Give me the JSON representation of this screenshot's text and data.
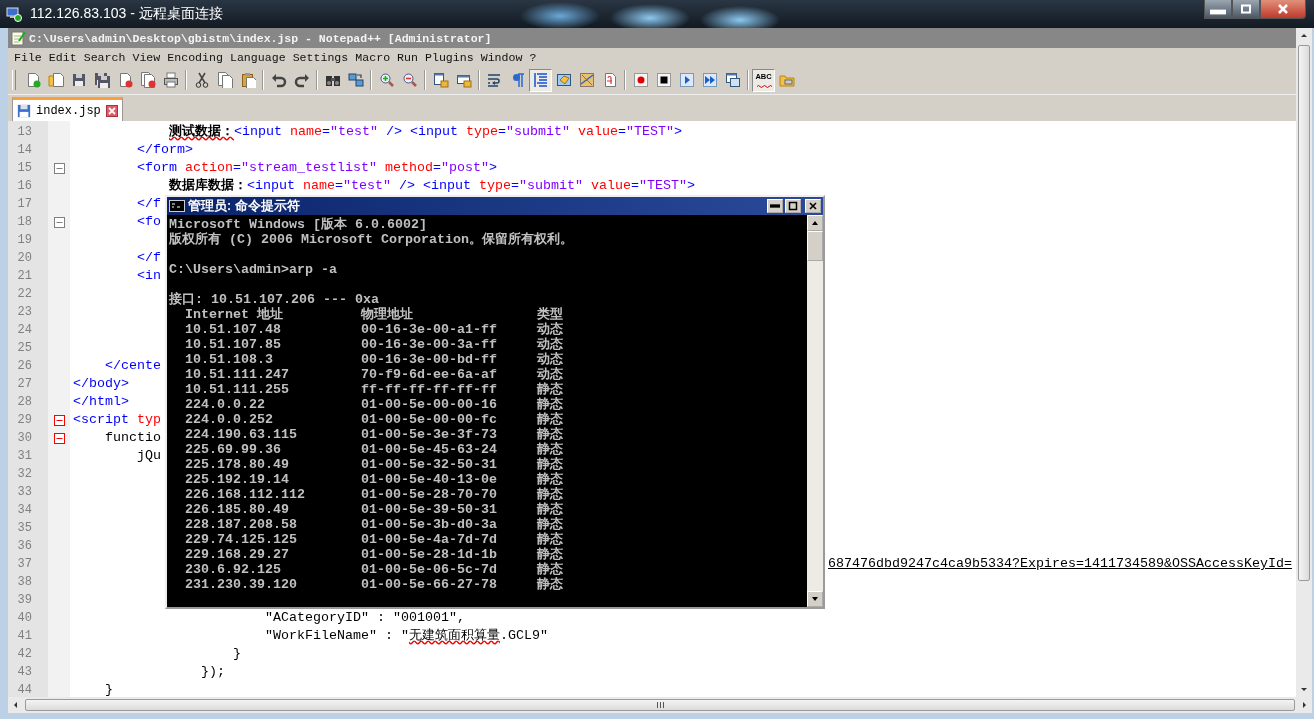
{
  "remote_window": {
    "title": "112.126.83.103 - 远程桌面连接"
  },
  "editor_window": {
    "title": "C:\\Users\\admin\\Desktop\\gbistm\\index.jsp - Notepad++ [Administrator]"
  },
  "menu": [
    "File",
    "Edit",
    "Search",
    "View",
    "Encoding",
    "Language",
    "Settings",
    "Macro",
    "Run",
    "Plugins",
    "Window",
    "?"
  ],
  "toolbar": [
    {
      "kind": "new",
      "pressed": false
    },
    {
      "kind": "open",
      "pressed": false
    },
    {
      "kind": "save",
      "pressed": false
    },
    {
      "kind": "save-all",
      "pressed": false
    },
    {
      "kind": "close",
      "pressed": false
    },
    {
      "kind": "close-all",
      "pressed": false
    },
    {
      "kind": "print",
      "pressed": false
    },
    {
      "kind": "separator"
    },
    {
      "kind": "cut",
      "pressed": false
    },
    {
      "kind": "copy",
      "pressed": false
    },
    {
      "kind": "paste",
      "pressed": false
    },
    {
      "kind": "separator"
    },
    {
      "kind": "undo",
      "pressed": false
    },
    {
      "kind": "redo",
      "pressed": false
    },
    {
      "kind": "separator"
    },
    {
      "kind": "find",
      "pressed": false
    },
    {
      "kind": "replace",
      "pressed": false
    },
    {
      "kind": "separator"
    },
    {
      "kind": "zoom-in",
      "pressed": false
    },
    {
      "kind": "zoom-out",
      "pressed": false
    },
    {
      "kind": "separator"
    },
    {
      "kind": "sync-v",
      "pressed": false
    },
    {
      "kind": "sync-h",
      "pressed": false
    },
    {
      "kind": "separator"
    },
    {
      "kind": "wrap",
      "pressed": false
    },
    {
      "kind": "all-chars",
      "pressed": false
    },
    {
      "kind": "indent-guide",
      "pressed": true
    },
    {
      "kind": "udl",
      "pressed": false
    },
    {
      "kind": "doc-map",
      "pressed": false
    },
    {
      "kind": "func-list",
      "pressed": false
    },
    {
      "kind": "separator"
    },
    {
      "kind": "record",
      "pressed": false
    },
    {
      "kind": "stop",
      "pressed": false
    },
    {
      "kind": "play",
      "pressed": false
    },
    {
      "kind": "play-multi",
      "pressed": false
    },
    {
      "kind": "save-macro",
      "pressed": false
    },
    {
      "kind": "separator"
    },
    {
      "kind": "spell",
      "label": "ABC",
      "pressed": true
    },
    {
      "kind": "folder",
      "pressed": false
    }
  ],
  "tabs": [
    {
      "label": "index.jsp",
      "selected": true
    }
  ],
  "lines": [
    {
      "num": "13",
      "segs": [
        {
          "kind": "bold-flagged",
          "t": "            测试数据："
        },
        {
          "kind": "tag",
          "t": "<input "
        },
        {
          "kind": "attr",
          "t": "name"
        },
        {
          "kind": "tag",
          "t": "="
        },
        {
          "kind": "value",
          "t": "\"test\""
        },
        {
          "kind": "tag",
          "t": " /> <input "
        },
        {
          "kind": "attr",
          "t": "type"
        },
        {
          "kind": "tag",
          "t": "="
        },
        {
          "kind": "value",
          "t": "\"submit\""
        },
        {
          "kind": "attr",
          "t": " value"
        },
        {
          "kind": "tag",
          "t": "="
        },
        {
          "kind": "value",
          "t": "\"TEST\""
        },
        {
          "kind": "tag",
          "t": ">"
        }
      ]
    },
    {
      "num": "14",
      "segs": [
        {
          "kind": "tag",
          "t": "        </form>"
        }
      ]
    },
    {
      "num": "15",
      "fold": {
        "expanded": true,
        "active": false
      },
      "segs": [
        {
          "kind": "tag",
          "t": "        <form "
        },
        {
          "kind": "attr",
          "t": "action"
        },
        {
          "kind": "tag",
          "t": "="
        },
        {
          "kind": "value",
          "t": "\"stream_testlist\""
        },
        {
          "kind": "attr",
          "t": " method"
        },
        {
          "kind": "tag",
          "t": "="
        },
        {
          "kind": "value",
          "t": "\"post\""
        },
        {
          "kind": "tag",
          "t": ">"
        }
      ]
    },
    {
      "num": "16",
      "segs": [
        {
          "kind": "bold",
          "t": "            数据库数据："
        },
        {
          "kind": "tag",
          "t": "<input "
        },
        {
          "kind": "attr",
          "t": "name"
        },
        {
          "kind": "tag",
          "t": "="
        },
        {
          "kind": "value",
          "t": "\"test\""
        },
        {
          "kind": "tag",
          "t": " /> <input "
        },
        {
          "kind": "attr",
          "t": "type"
        },
        {
          "kind": "tag",
          "t": "="
        },
        {
          "kind": "value",
          "t": "\"submit\""
        },
        {
          "kind": "attr",
          "t": " value"
        },
        {
          "kind": "tag",
          "t": "="
        },
        {
          "kind": "value",
          "t": "\"TEST\""
        },
        {
          "kind": "tag",
          "t": ">"
        }
      ]
    },
    {
      "num": "17",
      "segs": [
        {
          "kind": "tag",
          "t": "        </f"
        }
      ]
    },
    {
      "num": "18",
      "fold": {
        "expanded": true,
        "active": false
      },
      "segs": [
        {
          "kind": "tag",
          "t": "        <fo"
        }
      ]
    },
    {
      "num": "19"
    },
    {
      "num": "20",
      "segs": [
        {
          "kind": "tag",
          "t": "        </f"
        }
      ]
    },
    {
      "num": "21",
      "segs": [
        {
          "kind": "tag",
          "t": "        <in"
        }
      ]
    },
    {
      "num": "22"
    },
    {
      "num": "23"
    },
    {
      "num": "24"
    },
    {
      "num": "25"
    },
    {
      "num": "26",
      "segs": [
        {
          "kind": "tag",
          "t": "    </cente"
        }
      ]
    },
    {
      "num": "27",
      "segs": [
        {
          "kind": "tag",
          "t": "</body>"
        }
      ]
    },
    {
      "num": "28",
      "segs": [
        {
          "kind": "tag",
          "t": "</html>"
        }
      ]
    },
    {
      "num": "29",
      "fold": {
        "expanded": true,
        "active": true
      },
      "segs": [
        {
          "kind": "tag",
          "t": "<script "
        },
        {
          "kind": "attr",
          "t": "typ"
        }
      ]
    },
    {
      "num": "30",
      "fold": {
        "expanded": true,
        "active": true
      },
      "segs": [
        {
          "kind": "plain",
          "t": "    functio"
        }
      ]
    },
    {
      "num": "31",
      "segs": [
        {
          "kind": "plain",
          "t": "        jQu"
        }
      ]
    },
    {
      "num": "32"
    },
    {
      "num": "33"
    },
    {
      "num": "34"
    },
    {
      "num": "35"
    },
    {
      "num": "36"
    },
    {
      "num": "37",
      "tail": "687476dbd9247c4ca9b5334?Expires=1411734589&OSSAccessKeyId="
    },
    {
      "num": "38"
    },
    {
      "num": "39"
    },
    {
      "num": "40",
      "segs": [
        {
          "kind": "plain",
          "t": "                        \"ACategoryID\" : \"001001\","
        }
      ]
    },
    {
      "num": "41",
      "segs": [
        {
          "kind": "plain",
          "t": "                        \"WorkFileName\" : \""
        },
        {
          "kind": "flagged",
          "t": "无建筑面积算量"
        },
        {
          "kind": "plain",
          "t": ".GCL9\""
        }
      ]
    },
    {
      "num": "42",
      "segs": [
        {
          "kind": "plain",
          "t": "                    }"
        }
      ]
    },
    {
      "num": "43",
      "segs": [
        {
          "kind": "plain",
          "t": "                });"
        }
      ]
    },
    {
      "num": "44",
      "segs": [
        {
          "kind": "plain",
          "t": "    }"
        }
      ]
    }
  ],
  "console": {
    "title": "管理员: 命令提示符",
    "intro": [
      "Microsoft Windows [版本 6.0.6002]",
      "版权所有 (C) 2006 Microsoft Corporation。保留所有权利。"
    ],
    "command": "C:\\Users\\admin>arp -a",
    "interface": "接口: 10.51.107.206 --- 0xa",
    "header": {
      "ip": "Internet 地址",
      "mac": "物理地址",
      "type": "类型"
    },
    "rows": [
      {
        "ip": "10.51.107.48",
        "mac": "00-16-3e-00-a1-ff",
        "type": "动态"
      },
      {
        "ip": "10.51.107.85",
        "mac": "00-16-3e-00-3a-ff",
        "type": "动态"
      },
      {
        "ip": "10.51.108.3",
        "mac": "00-16-3e-00-bd-ff",
        "type": "动态"
      },
      {
        "ip": "10.51.111.247",
        "mac": "70-f9-6d-ee-6a-af",
        "type": "动态"
      },
      {
        "ip": "10.51.111.255",
        "mac": "ff-ff-ff-ff-ff-ff",
        "type": "静态"
      },
      {
        "ip": "224.0.0.22",
        "mac": "01-00-5e-00-00-16",
        "type": "静态"
      },
      {
        "ip": "224.0.0.252",
        "mac": "01-00-5e-00-00-fc",
        "type": "静态"
      },
      {
        "ip": "224.190.63.115",
        "mac": "01-00-5e-3e-3f-73",
        "type": "静态"
      },
      {
        "ip": "225.69.99.36",
        "mac": "01-00-5e-45-63-24",
        "type": "静态"
      },
      {
        "ip": "225.178.80.49",
        "mac": "01-00-5e-32-50-31",
        "type": "静态"
      },
      {
        "ip": "225.192.19.14",
        "mac": "01-00-5e-40-13-0e",
        "type": "静态"
      },
      {
        "ip": "226.168.112.112",
        "mac": "01-00-5e-28-70-70",
        "type": "静态"
      },
      {
        "ip": "226.185.80.49",
        "mac": "01-00-5e-39-50-31",
        "type": "静态"
      },
      {
        "ip": "228.187.208.58",
        "mac": "01-00-5e-3b-d0-3a",
        "type": "静态"
      },
      {
        "ip": "229.74.125.125",
        "mac": "01-00-5e-4a-7d-7d",
        "type": "静态"
      },
      {
        "ip": "229.168.29.27",
        "mac": "01-00-5e-28-1d-1b",
        "type": "静态"
      },
      {
        "ip": "230.6.92.125",
        "mac": "01-00-5e-06-5c-7d",
        "type": "静态"
      },
      {
        "ip": "231.230.39.120",
        "mac": "01-00-5e-66-27-78",
        "type": "静态"
      }
    ]
  }
}
